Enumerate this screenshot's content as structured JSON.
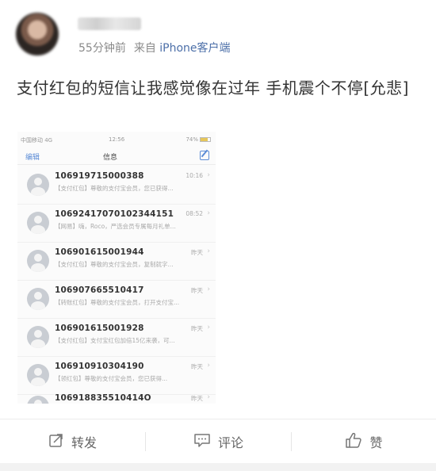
{
  "post": {
    "meta_time": "55分钟前",
    "meta_source_prefix": "来自",
    "meta_device": "iPhone客户端",
    "text": "支付红包的短信让我感觉像在过年 手机震个不停[允悲]"
  },
  "screenshot": {
    "status_carrier": "中国移动 4G",
    "status_time": "12:56",
    "status_battery": "74%",
    "nav_edit": "编辑",
    "nav_title": "信息",
    "messages": [
      {
        "number": "106919715000388",
        "time": "10:16",
        "preview": "【支付红包】尊敬的支付宝会员，您已获得..."
      },
      {
        "number": "10692417070102344151",
        "time": "08:52",
        "preview": "【网易】嗨，Roco，严选会员专属每月礼单..."
      },
      {
        "number": "106901615001944",
        "time": "昨天",
        "preview": "【支付红包】尊敬的支付宝会员，复制就字..."
      },
      {
        "number": "106907665510417",
        "time": "昨天",
        "preview": "【转账红包】尊敬的支付宝会员，打开支付宝..."
      },
      {
        "number": "106901615001928",
        "time": "昨天",
        "preview": "【支付红包】支付宝红包加倍15亿来袭，可..."
      },
      {
        "number": "106910910304190",
        "time": "昨天",
        "preview": "【领红包】尊敬的支付宝会员，您已获得..."
      },
      {
        "number": "106918835510414O",
        "time": "昨天",
        "preview": ""
      }
    ]
  },
  "actions": {
    "repost": "转发",
    "comment": "评论",
    "like": "赞"
  }
}
